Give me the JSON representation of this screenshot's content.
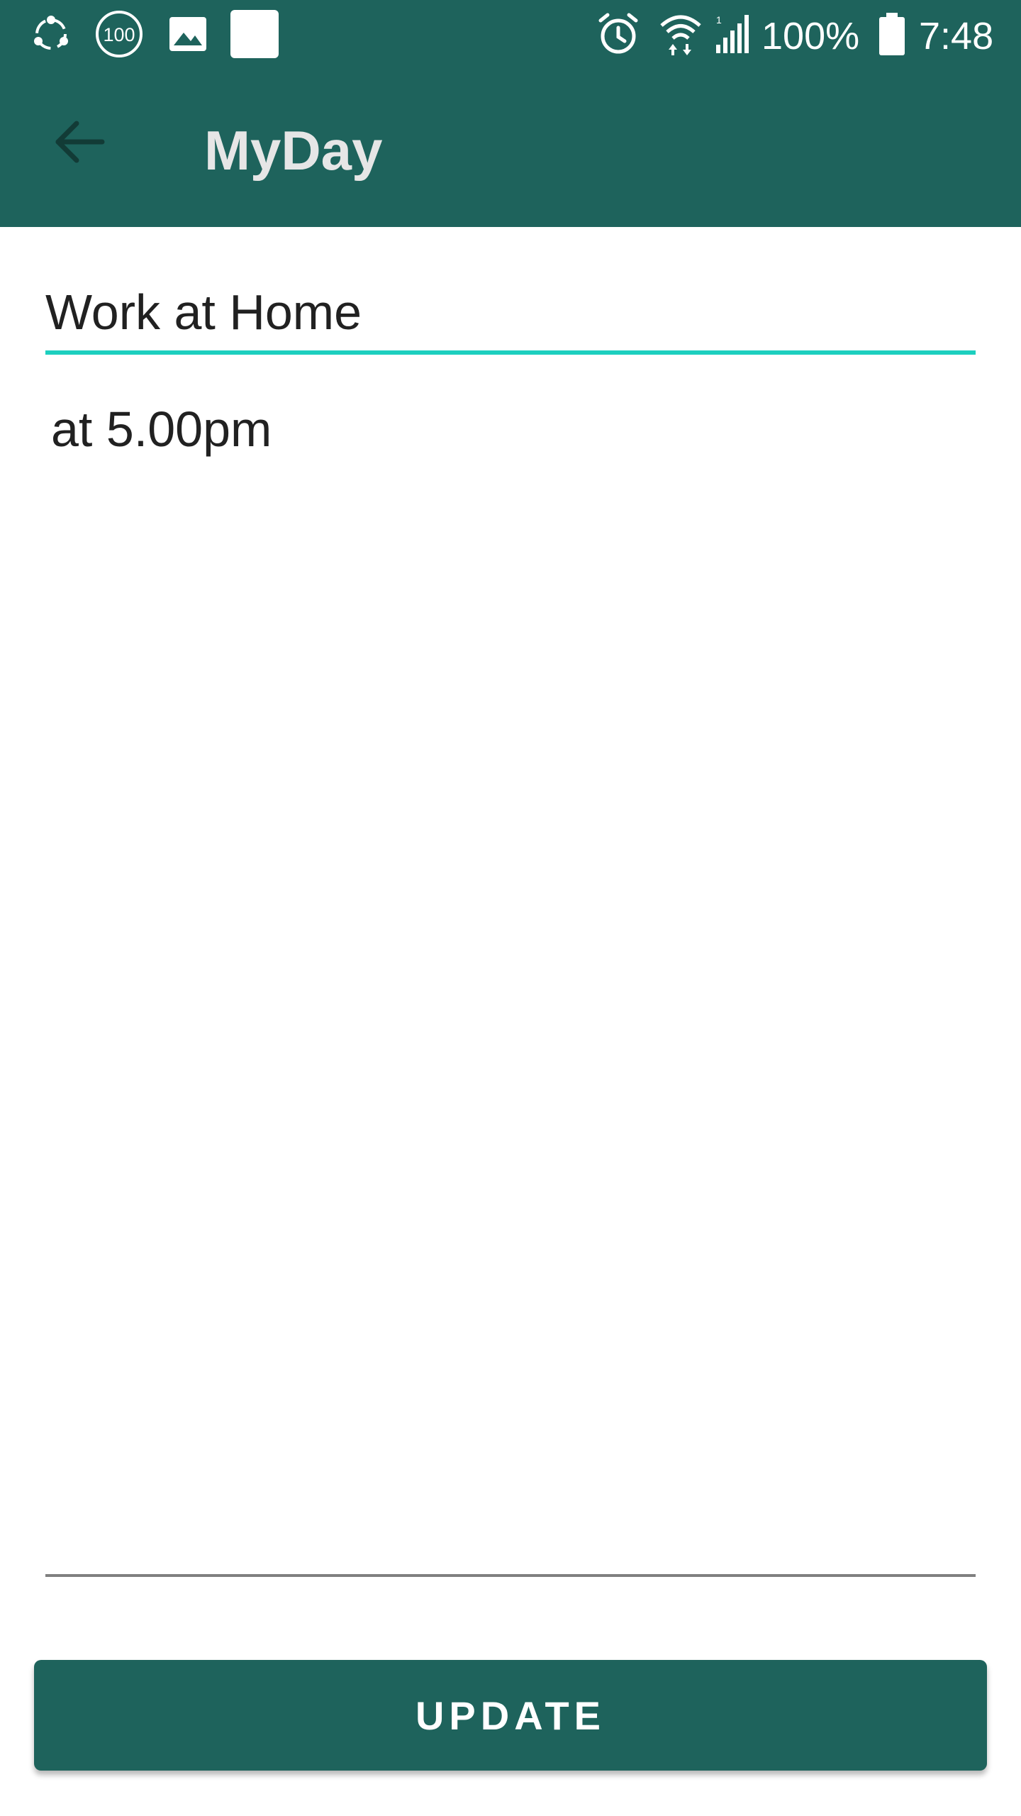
{
  "status_bar": {
    "battery_percent": "100%",
    "time": "7:48",
    "left_icons": [
      "share-sync-icon",
      "badge-100-icon",
      "image-icon",
      "blank-square-icon"
    ],
    "right_icons": [
      "alarm-icon",
      "wifi-icon",
      "signal-icon",
      "battery-icon"
    ],
    "badge_text": "100"
  },
  "app_bar": {
    "title": "MyDay",
    "back_icon": "arrow-back-icon",
    "background_color": "#1e635c"
  },
  "editor": {
    "title_value": "Work at Home",
    "body_value": "at 5.00pm",
    "focus_color": "#1dcfbf"
  },
  "actions": {
    "update_label": "UPDATE"
  }
}
